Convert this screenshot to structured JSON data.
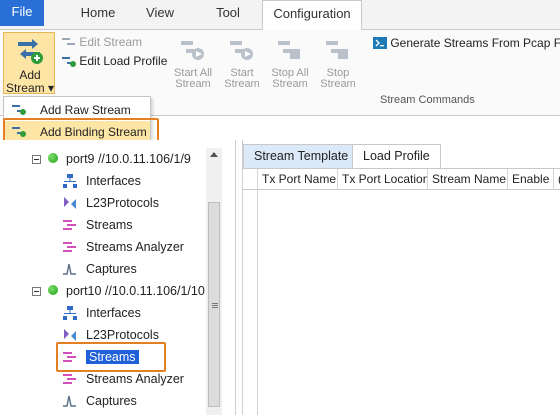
{
  "ribbon_tabs": [
    "File",
    "Home",
    "View",
    "Tool",
    "Configuration"
  ],
  "ribbon": {
    "add_stream_label_1": "Add",
    "add_stream_label_2": "Stream",
    "edit_stream": "Edit Stream",
    "edit_load_profile": "Edit Load Profile",
    "start_all_1": "Start All",
    "start_all_2": "Stream",
    "start_1": "Start",
    "start_2": "Stream",
    "stop_all_1": "Stop All",
    "stop_all_2": "Stream",
    "stop_1": "Stop",
    "stop_2": "Stream",
    "generate": "Generate Streams From Pcap File",
    "group_label": "Stream Commands"
  },
  "menu": {
    "items": [
      "Add Raw Stream",
      "Add Binding Stream"
    ]
  },
  "tree": {
    "port9": "port9 //10.0.11.106/1/9",
    "port10": "port10 //10.0.11.106/1/10",
    "children": [
      "Interfaces",
      "L23Protocols",
      "Streams",
      "Streams Analyzer",
      "Captures"
    ]
  },
  "panel": {
    "tabs": [
      "Stream Template",
      "Load Profile"
    ],
    "columns": [
      "Tx Port Name",
      "Tx Port Location",
      "Stream Name",
      "Enable",
      "("
    ]
  },
  "colors": {
    "accent": "#e67e22",
    "file_tab": "#2a6fd6",
    "selection": "#1f5fd8"
  }
}
